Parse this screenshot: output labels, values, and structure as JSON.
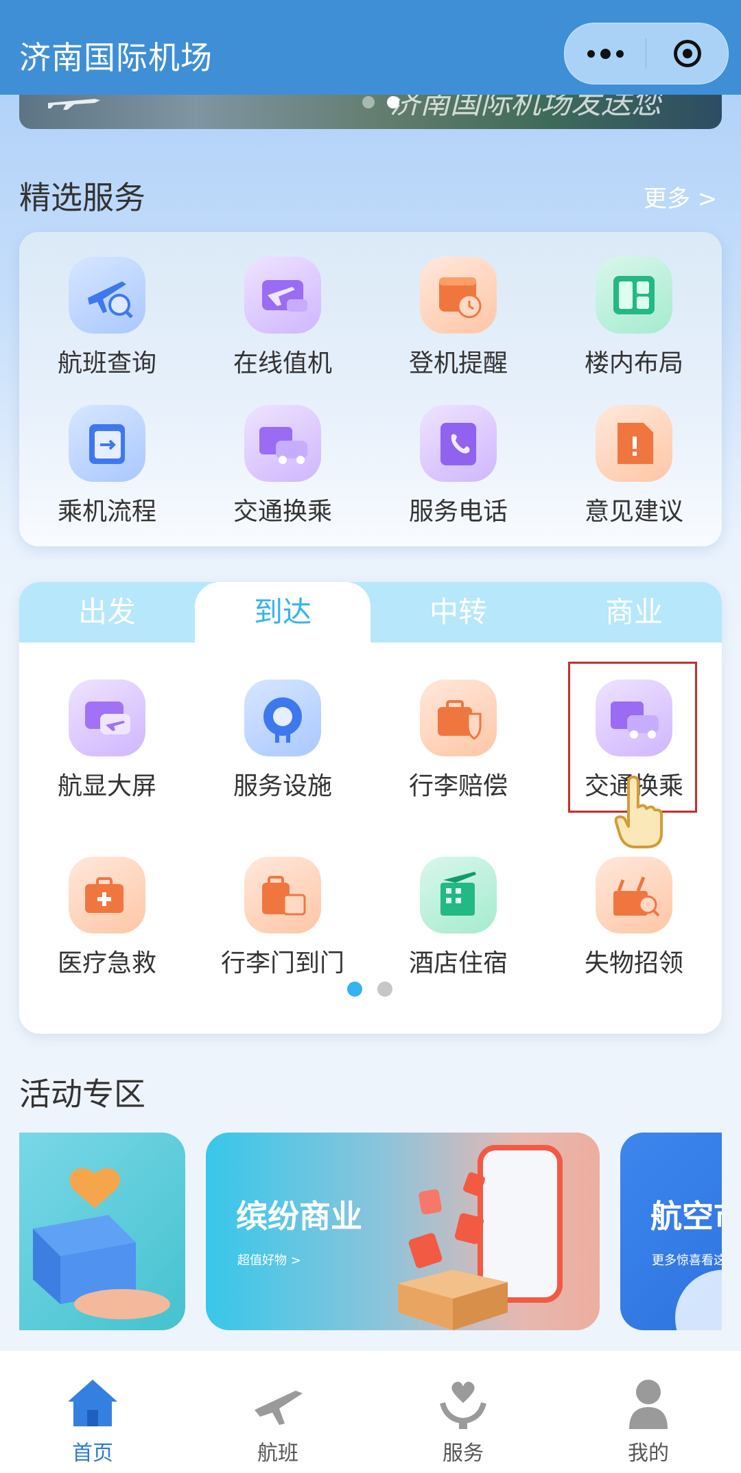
{
  "header": {
    "title": "济南国际机场"
  },
  "banner": {
    "text": "济南国际机场发送您"
  },
  "featured": {
    "title": "精选服务",
    "more": "更多 >",
    "items": [
      {
        "label": "航班查询",
        "icon": "flight-search-icon"
      },
      {
        "label": "在线值机",
        "icon": "online-checkin-icon"
      },
      {
        "label": "登机提醒",
        "icon": "boarding-reminder-icon"
      },
      {
        "label": "楼内布局",
        "icon": "terminal-layout-icon"
      },
      {
        "label": "乘机流程",
        "icon": "boarding-process-icon"
      },
      {
        "label": "交通换乘",
        "icon": "transport-transfer-icon"
      },
      {
        "label": "服务电话",
        "icon": "service-phone-icon"
      },
      {
        "label": "意见建议",
        "icon": "feedback-icon"
      }
    ]
  },
  "tabs": {
    "labels": [
      "出发",
      "到达",
      "中转",
      "商业"
    ],
    "active": 1,
    "items": [
      {
        "label": "航显大屏",
        "icon": "flight-display-icon"
      },
      {
        "label": "服务设施",
        "icon": "service-facility-icon"
      },
      {
        "label": "行李赔偿",
        "icon": "baggage-compensation-icon"
      },
      {
        "label": "交通换乘",
        "icon": "transport-transfer-icon"
      },
      {
        "label": "医疗急救",
        "icon": "medical-aid-icon"
      },
      {
        "label": "行李门到门",
        "icon": "baggage-delivery-icon"
      },
      {
        "label": "酒店住宿",
        "icon": "hotel-icon"
      },
      {
        "label": "失物招领",
        "icon": "lost-found-icon"
      }
    ]
  },
  "activity": {
    "title": "活动专区",
    "cards": [
      {
        "title": "",
        "sub": ""
      },
      {
        "title": "缤纷商业",
        "sub": "超值好物 >"
      },
      {
        "title": "航空市",
        "sub": "更多惊喜看这"
      }
    ]
  },
  "nav": {
    "items": [
      {
        "label": "首页",
        "icon": "home-icon"
      },
      {
        "label": "航班",
        "icon": "flight-icon"
      },
      {
        "label": "服务",
        "icon": "service-icon"
      },
      {
        "label": "我的",
        "icon": "profile-icon"
      }
    ]
  },
  "colors": {
    "header": "#3f8fd6",
    "accent": "#33b3ee",
    "nav_active": "#2b79d6",
    "highlight": "#c0302c"
  }
}
